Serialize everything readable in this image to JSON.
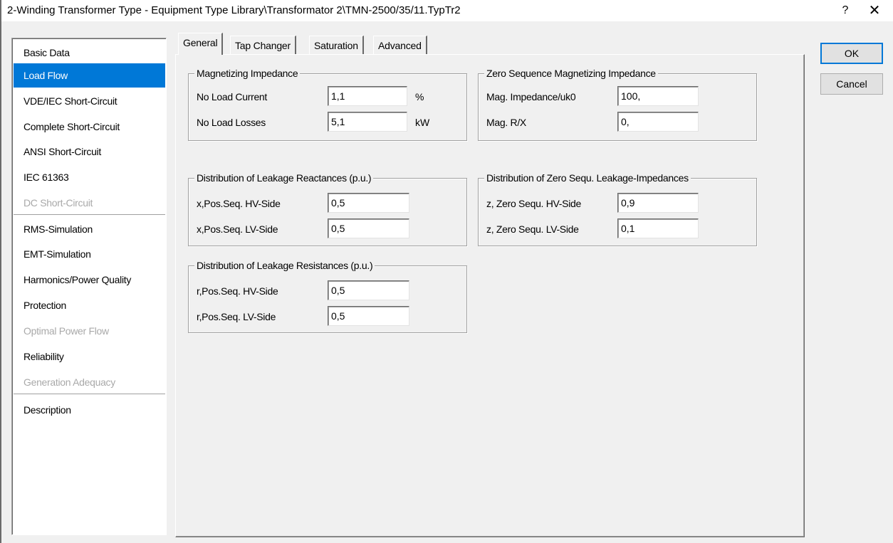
{
  "window": {
    "title": "2-Winding Transformer Type - Equipment Type Library\\Transformator 2\\TMN-2500/35/11.TypTr2",
    "help_label": "?",
    "close_label": "✕"
  },
  "nav": {
    "items": [
      {
        "label": "Basic Data",
        "state": "normal"
      },
      {
        "label": "Load Flow",
        "state": "selected"
      },
      {
        "label": "VDE/IEC Short-Circuit",
        "state": "normal"
      },
      {
        "label": "Complete Short-Circuit",
        "state": "normal"
      },
      {
        "label": "ANSI Short-Circuit",
        "state": "normal"
      },
      {
        "label": "IEC 61363",
        "state": "normal"
      },
      {
        "label": "DC Short-Circuit",
        "state": "disabled"
      },
      {
        "label": "RMS-Simulation",
        "state": "normal"
      },
      {
        "label": "EMT-Simulation",
        "state": "normal"
      },
      {
        "label": "Harmonics/Power Quality",
        "state": "normal"
      },
      {
        "label": "Protection",
        "state": "normal"
      },
      {
        "label": "Optimal Power Flow",
        "state": "disabled"
      },
      {
        "label": "Reliability",
        "state": "normal"
      },
      {
        "label": "Generation Adequacy",
        "state": "disabled"
      },
      {
        "label": "Description",
        "state": "normal"
      }
    ]
  },
  "tabs": [
    {
      "label": "General",
      "active": true
    },
    {
      "label": "Tap Changer",
      "active": false
    },
    {
      "label": "Saturation",
      "active": false
    },
    {
      "label": "Advanced",
      "active": false
    }
  ],
  "groups": {
    "magnetizing": {
      "title": "Magnetizing Impedance",
      "no_load_current": {
        "label": "No Load Current",
        "value": "1,1",
        "unit": "%"
      },
      "no_load_losses": {
        "label": "No Load Losses",
        "value": "5,1",
        "unit": "kW"
      }
    },
    "zero_seq_mag": {
      "title": "Zero Sequence Magnetizing Impedance",
      "mag_impedance": {
        "label": "Mag. Impedance/uk0",
        "value": "100,"
      },
      "mag_rx": {
        "label": "Mag. R/X",
        "value": "0,"
      }
    },
    "leak_react": {
      "title": "Distribution of Leakage Reactances (p.u.)",
      "hv": {
        "label": "x,Pos.Seq. HV-Side",
        "value": "0,5"
      },
      "lv": {
        "label": "x,Pos.Seq. LV-Side",
        "value": "0,5"
      }
    },
    "zero_leak": {
      "title": "Distribution of Zero Sequ. Leakage-Impedances",
      "hv": {
        "label": "z, Zero Sequ. HV-Side",
        "value": "0,9"
      },
      "lv": {
        "label": "z, Zero Sequ. LV-Side",
        "value": "0,1"
      }
    },
    "leak_res": {
      "title": "Distribution of Leakage Resistances (p.u.)",
      "hv": {
        "label": "r,Pos.Seq. HV-Side",
        "value": "0,5"
      },
      "lv": {
        "label": "r,Pos.Seq. LV-Side",
        "value": "0,5"
      }
    }
  },
  "buttons": {
    "ok_label": "OK",
    "cancel_label": "Cancel"
  }
}
